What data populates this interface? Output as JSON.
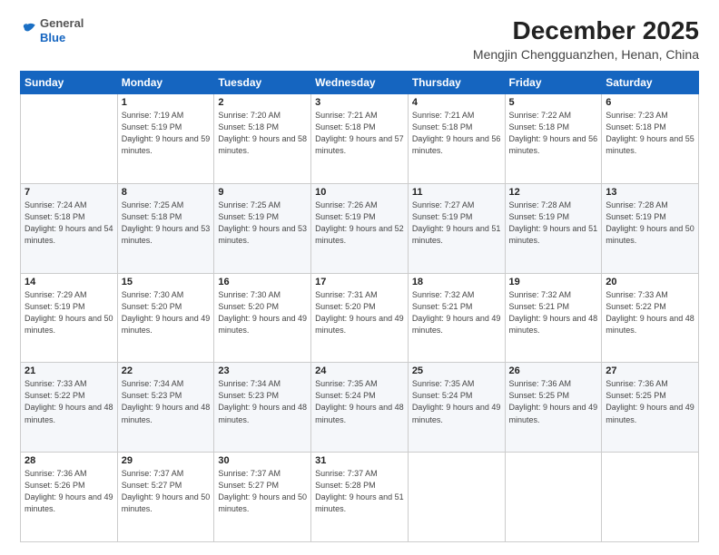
{
  "header": {
    "logo_line1": "General",
    "logo_line2": "Blue",
    "month_year": "December 2025",
    "location": "Mengjin Chengguanzhen, Henan, China"
  },
  "days_of_week": [
    "Sunday",
    "Monday",
    "Tuesday",
    "Wednesday",
    "Thursday",
    "Friday",
    "Saturday"
  ],
  "weeks": [
    [
      {
        "day": "",
        "info": ""
      },
      {
        "day": "1",
        "info": "Sunrise: 7:19 AM\nSunset: 5:19 PM\nDaylight: 9 hours\nand 59 minutes."
      },
      {
        "day": "2",
        "info": "Sunrise: 7:20 AM\nSunset: 5:18 PM\nDaylight: 9 hours\nand 58 minutes."
      },
      {
        "day": "3",
        "info": "Sunrise: 7:21 AM\nSunset: 5:18 PM\nDaylight: 9 hours\nand 57 minutes."
      },
      {
        "day": "4",
        "info": "Sunrise: 7:21 AM\nSunset: 5:18 PM\nDaylight: 9 hours\nand 56 minutes."
      },
      {
        "day": "5",
        "info": "Sunrise: 7:22 AM\nSunset: 5:18 PM\nDaylight: 9 hours\nand 56 minutes."
      },
      {
        "day": "6",
        "info": "Sunrise: 7:23 AM\nSunset: 5:18 PM\nDaylight: 9 hours\nand 55 minutes."
      }
    ],
    [
      {
        "day": "7",
        "info": "Sunrise: 7:24 AM\nSunset: 5:18 PM\nDaylight: 9 hours\nand 54 minutes."
      },
      {
        "day": "8",
        "info": "Sunrise: 7:25 AM\nSunset: 5:18 PM\nDaylight: 9 hours\nand 53 minutes."
      },
      {
        "day": "9",
        "info": "Sunrise: 7:25 AM\nSunset: 5:19 PM\nDaylight: 9 hours\nand 53 minutes."
      },
      {
        "day": "10",
        "info": "Sunrise: 7:26 AM\nSunset: 5:19 PM\nDaylight: 9 hours\nand 52 minutes."
      },
      {
        "day": "11",
        "info": "Sunrise: 7:27 AM\nSunset: 5:19 PM\nDaylight: 9 hours\nand 51 minutes."
      },
      {
        "day": "12",
        "info": "Sunrise: 7:28 AM\nSunset: 5:19 PM\nDaylight: 9 hours\nand 51 minutes."
      },
      {
        "day": "13",
        "info": "Sunrise: 7:28 AM\nSunset: 5:19 PM\nDaylight: 9 hours\nand 50 minutes."
      }
    ],
    [
      {
        "day": "14",
        "info": "Sunrise: 7:29 AM\nSunset: 5:19 PM\nDaylight: 9 hours\nand 50 minutes."
      },
      {
        "day": "15",
        "info": "Sunrise: 7:30 AM\nSunset: 5:20 PM\nDaylight: 9 hours\nand 49 minutes."
      },
      {
        "day": "16",
        "info": "Sunrise: 7:30 AM\nSunset: 5:20 PM\nDaylight: 9 hours\nand 49 minutes."
      },
      {
        "day": "17",
        "info": "Sunrise: 7:31 AM\nSunset: 5:20 PM\nDaylight: 9 hours\nand 49 minutes."
      },
      {
        "day": "18",
        "info": "Sunrise: 7:32 AM\nSunset: 5:21 PM\nDaylight: 9 hours\nand 49 minutes."
      },
      {
        "day": "19",
        "info": "Sunrise: 7:32 AM\nSunset: 5:21 PM\nDaylight: 9 hours\nand 48 minutes."
      },
      {
        "day": "20",
        "info": "Sunrise: 7:33 AM\nSunset: 5:22 PM\nDaylight: 9 hours\nand 48 minutes."
      }
    ],
    [
      {
        "day": "21",
        "info": "Sunrise: 7:33 AM\nSunset: 5:22 PM\nDaylight: 9 hours\nand 48 minutes."
      },
      {
        "day": "22",
        "info": "Sunrise: 7:34 AM\nSunset: 5:23 PM\nDaylight: 9 hours\nand 48 minutes."
      },
      {
        "day": "23",
        "info": "Sunrise: 7:34 AM\nSunset: 5:23 PM\nDaylight: 9 hours\nand 48 minutes."
      },
      {
        "day": "24",
        "info": "Sunrise: 7:35 AM\nSunset: 5:24 PM\nDaylight: 9 hours\nand 48 minutes."
      },
      {
        "day": "25",
        "info": "Sunrise: 7:35 AM\nSunset: 5:24 PM\nDaylight: 9 hours\nand 49 minutes."
      },
      {
        "day": "26",
        "info": "Sunrise: 7:36 AM\nSunset: 5:25 PM\nDaylight: 9 hours\nand 49 minutes."
      },
      {
        "day": "27",
        "info": "Sunrise: 7:36 AM\nSunset: 5:25 PM\nDaylight: 9 hours\nand 49 minutes."
      }
    ],
    [
      {
        "day": "28",
        "info": "Sunrise: 7:36 AM\nSunset: 5:26 PM\nDaylight: 9 hours\nand 49 minutes."
      },
      {
        "day": "29",
        "info": "Sunrise: 7:37 AM\nSunset: 5:27 PM\nDaylight: 9 hours\nand 50 minutes."
      },
      {
        "day": "30",
        "info": "Sunrise: 7:37 AM\nSunset: 5:27 PM\nDaylight: 9 hours\nand 50 minutes."
      },
      {
        "day": "31",
        "info": "Sunrise: 7:37 AM\nSunset: 5:28 PM\nDaylight: 9 hours\nand 51 minutes."
      },
      {
        "day": "",
        "info": ""
      },
      {
        "day": "",
        "info": ""
      },
      {
        "day": "",
        "info": ""
      }
    ]
  ]
}
